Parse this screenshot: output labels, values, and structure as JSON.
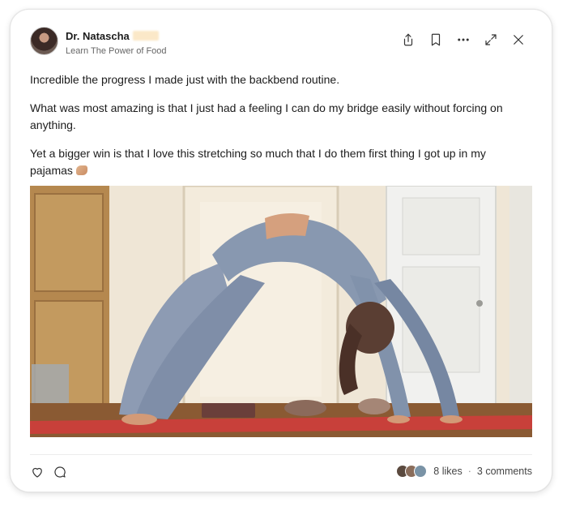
{
  "post": {
    "author_name": "Dr. Natascha",
    "community": "Learn The Power of Food",
    "paragraphs": [
      "Incredible the progress I made just with the backbend routine.",
      "What was most amazing is that I just had a feeling I can do my bridge easily without forcing on anything.",
      "Yet a bigger win is that I love this stretching so much that I do them first thing I got up in my pajamas"
    ],
    "media_description_icon": "photo"
  },
  "header_actions": [
    {
      "name": "share-icon"
    },
    {
      "name": "bookmark-icon"
    },
    {
      "name": "more-options-icon"
    },
    {
      "name": "expand-icon"
    },
    {
      "name": "close-icon"
    }
  ],
  "footer": {
    "likes": "8 likes",
    "separator": "·",
    "comments": "3 comments",
    "liker_avatar_colors": [
      "#5b4a3f",
      "#8a6d5b",
      "#7a93a6"
    ]
  },
  "colors": {
    "text": "#1c1c1c",
    "muted": "#666666",
    "mat": "#c8403a",
    "clothing": "#8898b0"
  }
}
